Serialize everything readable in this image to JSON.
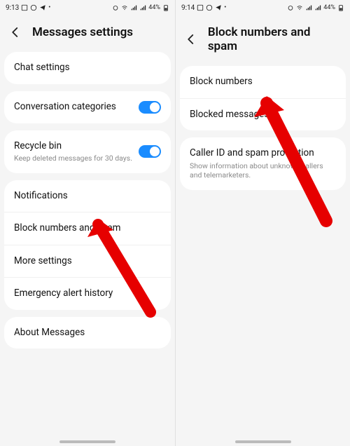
{
  "left": {
    "status": {
      "time": "9:13",
      "battery": "44%"
    },
    "header": {
      "title": "Messages settings"
    },
    "group1": {
      "chat": "Chat settings"
    },
    "group2": {
      "conv": "Conversation categories"
    },
    "group3": {
      "recycle_title": "Recycle bin",
      "recycle_sub": "Keep deleted messages for 30 days."
    },
    "group4": {
      "notifications": "Notifications",
      "block": "Block numbers and spam",
      "more": "More settings",
      "emergency": "Emergency alert history"
    },
    "group5": {
      "about": "About Messages"
    }
  },
  "right": {
    "status": {
      "time": "9:14",
      "battery": "44%"
    },
    "header": {
      "title": "Block numbers and spam"
    },
    "group1": {
      "block_numbers": "Block numbers",
      "blocked_messages": "Blocked messages"
    },
    "group2": {
      "caller_title": "Caller ID and spam protection",
      "caller_sub": "Show information about unknown callers and telemarketers."
    }
  }
}
